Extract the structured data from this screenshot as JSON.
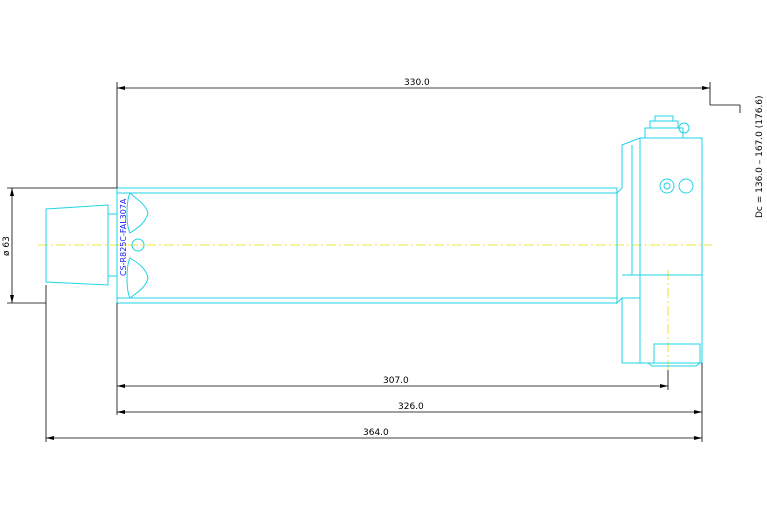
{
  "drawing": {
    "part_number": "CS-R825C-FAL307A",
    "colors": {
      "outline": "#1fd3e6",
      "dimension": "#000000",
      "centerline": "#e8e000",
      "part_text": "#1a1aff"
    },
    "dimensions": {
      "top_length": "330.0",
      "len_307": "307.0",
      "len_326": "326.0",
      "len_364": "364.0",
      "diameter": "ø 63",
      "dc_range": "Dc = 136.0 – 167.0 (176.6)"
    }
  }
}
